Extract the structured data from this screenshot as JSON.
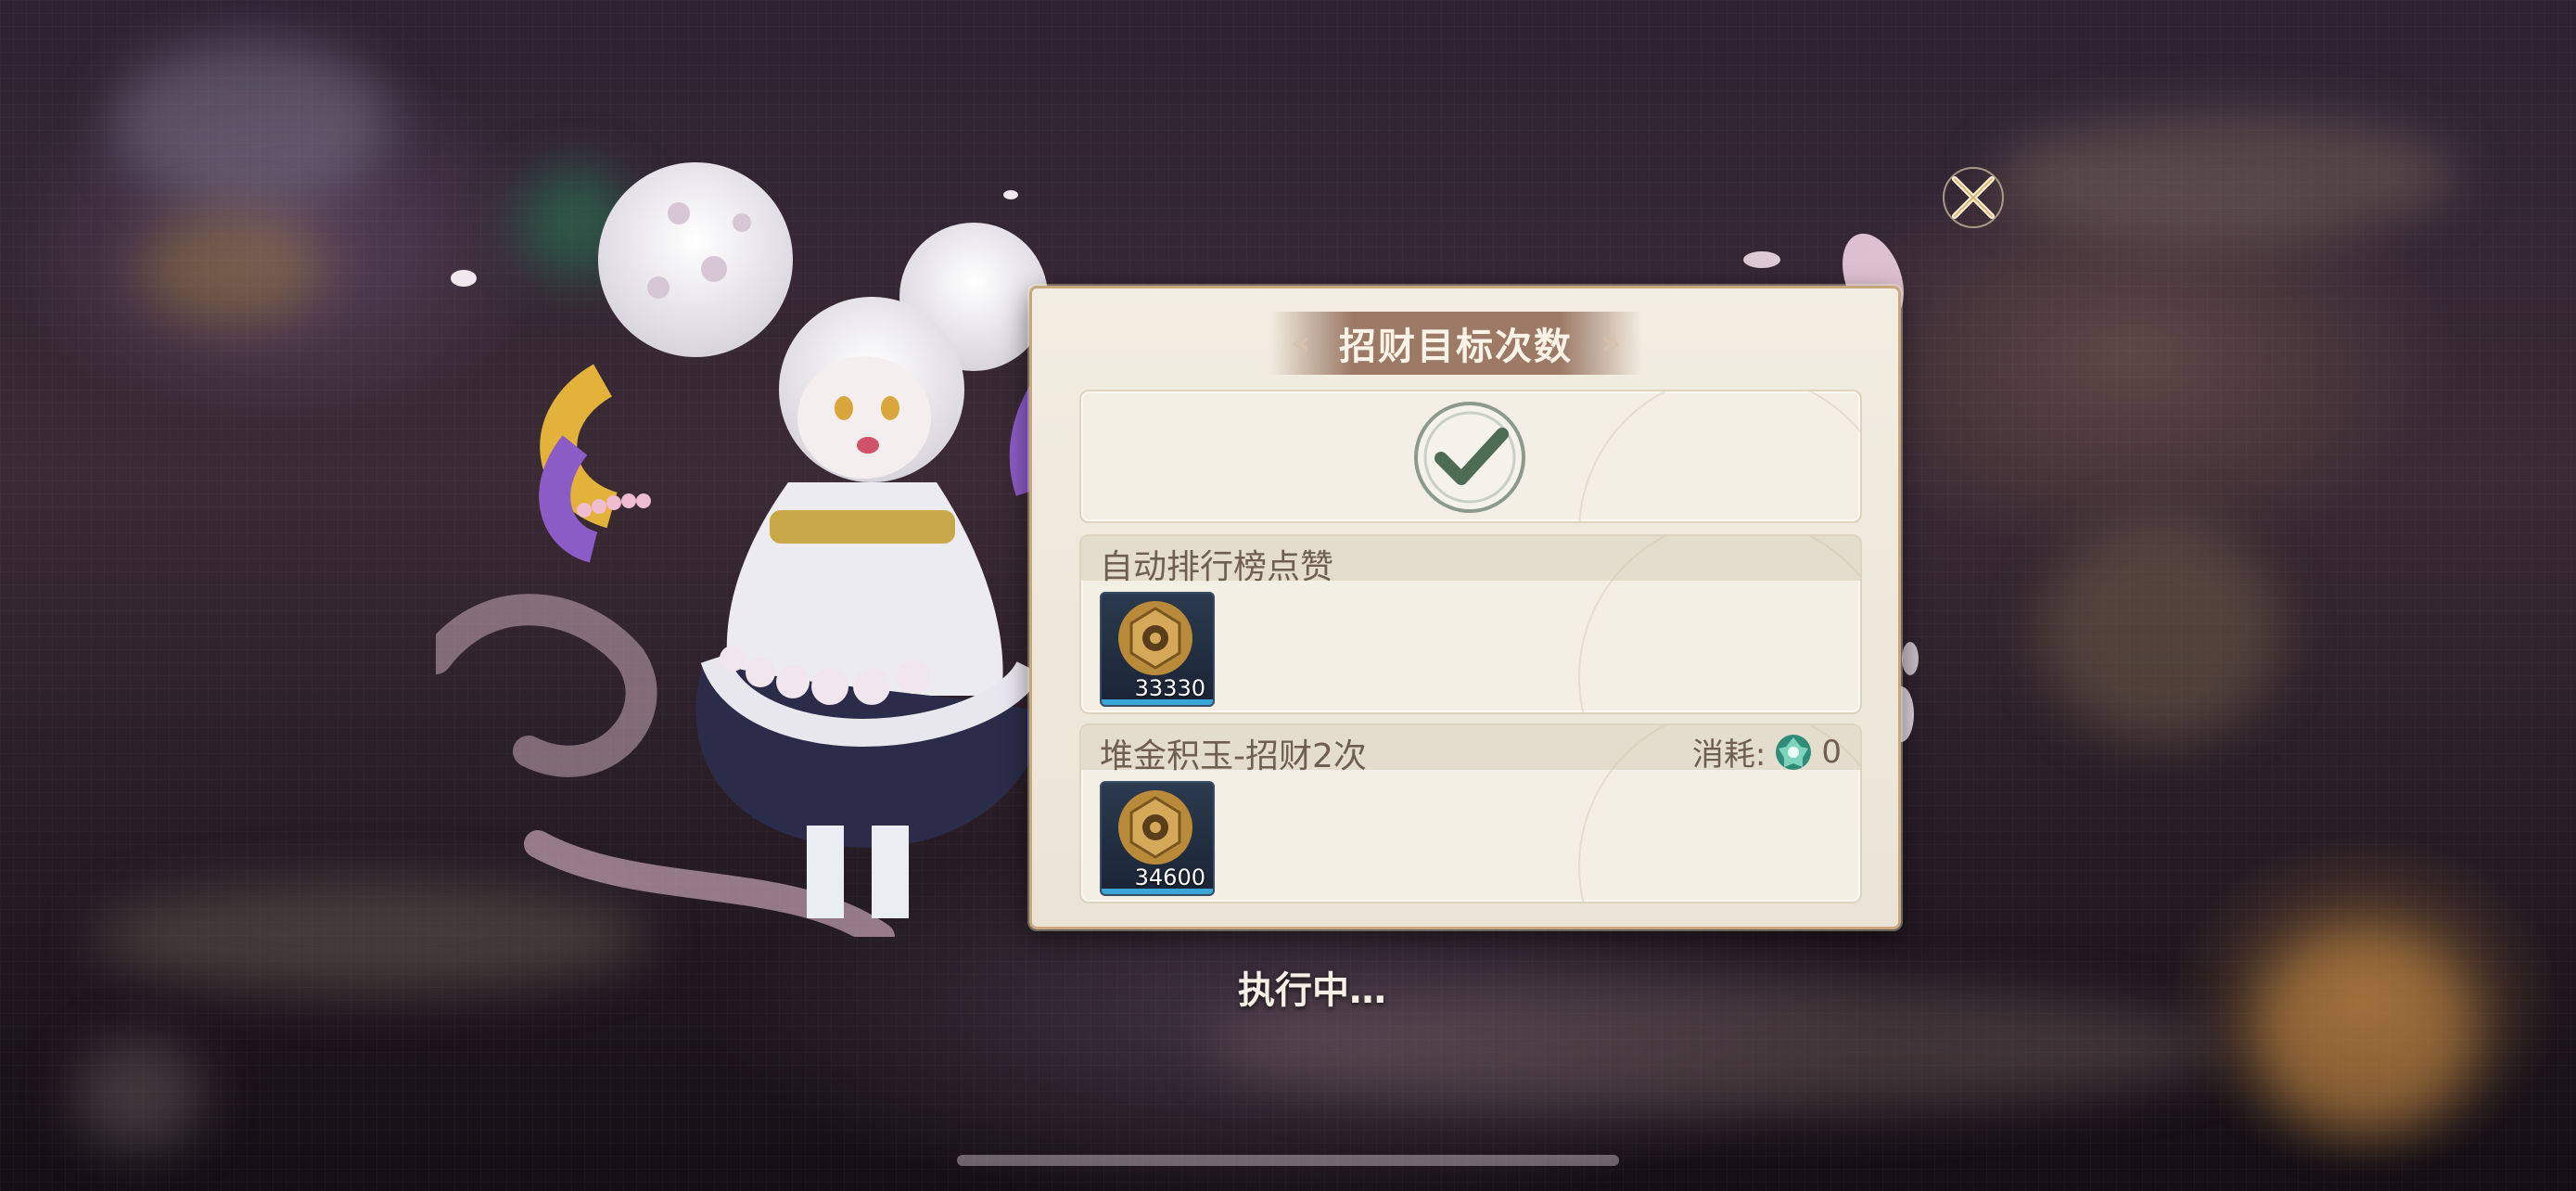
{
  "dialog": {
    "title": "招财目标次数",
    "status": "执行中…"
  },
  "tasks": [
    {
      "label": "自动排行榜点赞",
      "reward": {
        "icon": "gold-medallion-icon",
        "count": "33330"
      }
    },
    {
      "label": "堆金积玉-招财2次",
      "cost_label": "消耗:",
      "cost_value": "0",
      "cost_icon": "jade-gem-icon",
      "reward": {
        "icon": "gold-medallion-icon",
        "count": "34600"
      }
    }
  ],
  "colors": {
    "panel_bg": "#f2ede2",
    "panel_border": "#c9a77c",
    "title_banner": "#9c7a66",
    "card_label": "#6f5e52",
    "check_green": "#4e6b53"
  }
}
